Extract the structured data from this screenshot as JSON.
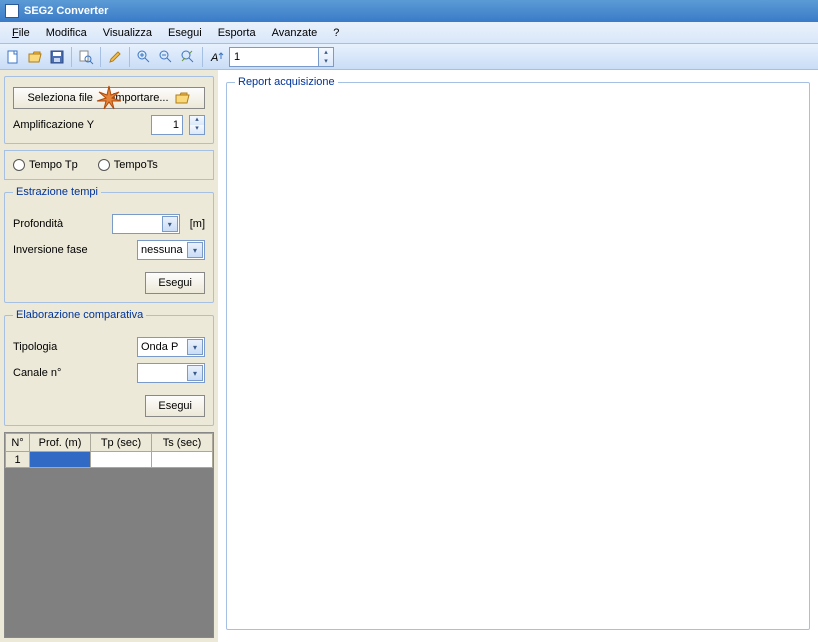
{
  "title": "SEG2 Converter",
  "menu": [
    "File",
    "Modifica",
    "Visualizza",
    "Esegui",
    "Esporta",
    "Avanzate",
    "?"
  ],
  "toolbar": {
    "num_value": "1"
  },
  "filebtn": {
    "label_a": "Seleziona file",
    "label_b": "importare..."
  },
  "amp": {
    "label": "Amplificazione Y",
    "value": "1"
  },
  "radios": {
    "tp": "Tempo Tp",
    "ts": "TempoTs"
  },
  "estrazione": {
    "legend": "Estrazione tempi",
    "profondita_label": "Profondità",
    "profondita_unit": "[m]",
    "inversione_label": "Inversione fase",
    "inversione_value": "nessuna",
    "esegui": "Esegui"
  },
  "elaborazione": {
    "legend": "Elaborazione comparativa",
    "tipologia_label": "Tipologia",
    "tipologia_value": "Onda P",
    "canale_label": "Canale n°",
    "esegui": "Esegui"
  },
  "table": {
    "headers": [
      "N°",
      "Prof. (m)",
      "Tp (sec)",
      "Ts (sec)"
    ],
    "row1_num": "1"
  },
  "report": {
    "legend": "Report acquisizione"
  }
}
